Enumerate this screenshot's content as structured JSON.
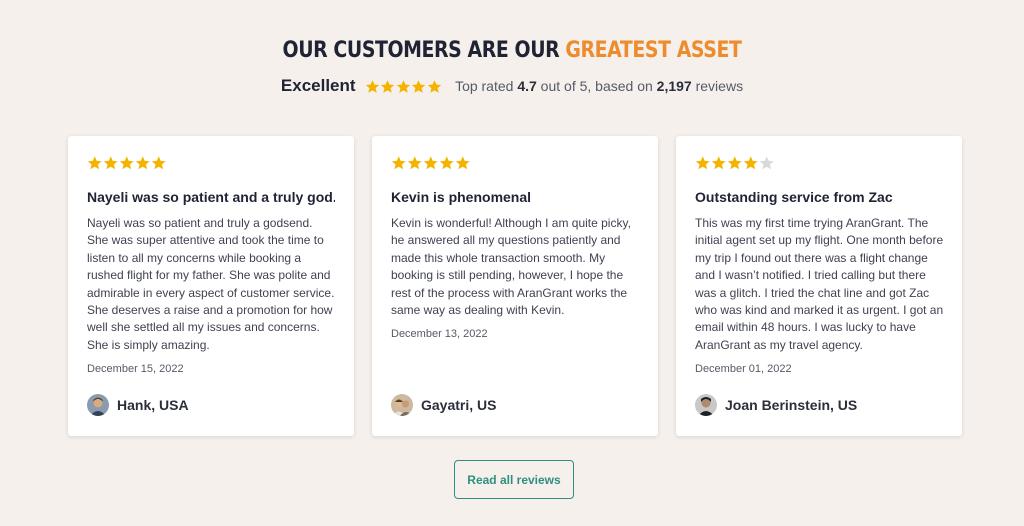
{
  "heading": {
    "main": "OUR CUSTOMERS ARE OUR ",
    "accent": "GREATEST ASSET"
  },
  "summary": {
    "label": "Excellent",
    "rating_stars": 5,
    "rated_prefix": "Top rated ",
    "rating": "4.7",
    "rated_middle": " out of 5, based on ",
    "review_count": "2,197",
    "rated_suffix": " reviews"
  },
  "colors": {
    "star": "#f5b301",
    "star_empty": "#d9d9d9",
    "accent": "#ec8c2d",
    "button": "#2f8f7e"
  },
  "reviews": [
    {
      "stars": 5,
      "title": "Nayeli was so patient and a truly god...",
      "body": "Nayeli was so patient and truly a godsend. She was super attentive and took the time to listen to all my concerns while booking a rushed flight for my father. She was polite and admirable in every aspect of customer service. She deserves a raise and a promotion for how well she settled all my issues and concerns. She is simply amazing.",
      "date": "December 15, 2022",
      "author": "Hank, USA"
    },
    {
      "stars": 5,
      "title": "Kevin is phenomenal",
      "body": "Kevin is wonderful! Although I am quite picky, he answered all my questions patiently and made this whole transaction smooth. My booking is still pending, however, I hope the rest of the process with AranGrant works the same way as dealing with Kevin.",
      "date": "December 13, 2022",
      "author": "Gayatri, US"
    },
    {
      "stars": 4,
      "title": "Outstanding service from Zac",
      "body": "This was my first time trying AranGrant. The initial agent set up my flight. One month before my trip I found out there was a flight change and I wasn’t notified. I tried calling but there was a glitch. I tried the chat line and got Zac who was kind and marked it as urgent. I got an email within 48 hours. I was lucky to have AranGrant as my travel agency.",
      "date": "December 01, 2022",
      "author": "Joan Berinstein, US"
    }
  ],
  "button": {
    "label": "Read all reviews"
  }
}
